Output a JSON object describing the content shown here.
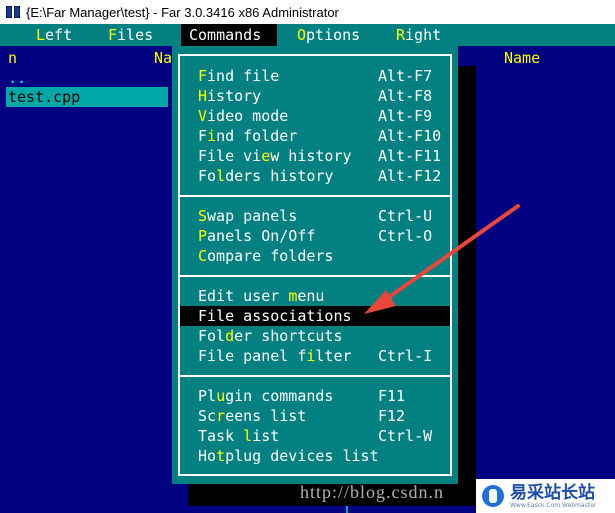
{
  "window": {
    "title": "{E:\\Far Manager\\test} - Far 3.0.3416 x86 Administrator"
  },
  "menubar": {
    "items": [
      {
        "hk": "L",
        "rest": "eft"
      },
      {
        "hk": "F",
        "rest": "iles"
      },
      {
        "hk": "C",
        "rest": "ommands"
      },
      {
        "hk": "O",
        "rest": "ptions"
      },
      {
        "hk": "R",
        "rest": "ight"
      }
    ]
  },
  "left_panel": {
    "col_left": "n",
    "col_right": "Na",
    "files": [
      "..",
      "test.cpp"
    ]
  },
  "right_panel": {
    "col": "Name"
  },
  "commands_menu": {
    "items": [
      {
        "pre": "",
        "hk": "F",
        "post": "ind file",
        "key": "Alt-F7"
      },
      {
        "pre": "",
        "hk": "H",
        "post": "istory",
        "key": "Alt-F8"
      },
      {
        "pre": "",
        "hk": "V",
        "post": "ideo mode",
        "key": "Alt-F9"
      },
      {
        "pre": "F",
        "hk": "i",
        "post": "nd folder",
        "key": "Alt-F10"
      },
      {
        "pre": "File vi",
        "hk": "e",
        "post": "w history",
        "key": "Alt-F11"
      },
      {
        "pre": "Fo",
        "hk": "l",
        "post": "ders history",
        "key": "Alt-F12"
      },
      {
        "pre": "",
        "hk": "S",
        "post": "wap panels",
        "key": "Ctrl-U"
      },
      {
        "pre": "",
        "hk": "P",
        "post": "anels On/Off",
        "key": "Ctrl-O"
      },
      {
        "pre": "",
        "hk": "C",
        "post": "ompare folders",
        "key": ""
      },
      {
        "pre": "Edit user ",
        "hk": "m",
        "post": "enu",
        "key": ""
      },
      {
        "pre": "File ",
        "hk": "a",
        "post": "ssociations",
        "key": ""
      },
      {
        "pre": "Fol",
        "hk": "d",
        "post": "er shortcuts",
        "key": ""
      },
      {
        "pre": "File panel f",
        "hk": "i",
        "post": "lter",
        "key": "Ctrl-I"
      },
      {
        "pre": "Pl",
        "hk": "u",
        "post": "gin commands",
        "key": "F11"
      },
      {
        "pre": "Sc",
        "hk": "r",
        "post": "eens list",
        "key": "F12"
      },
      {
        "pre": "Task ",
        "hk": "l",
        "post": "ist",
        "key": "Ctrl-W"
      },
      {
        "pre": "Ho",
        "hk": "t",
        "post": "plug devices list",
        "key": ""
      }
    ]
  },
  "watermark": {
    "text": "http://blog.csdn.n"
  },
  "brand": {
    "text": "易采站长站",
    "sub": "Www.Easck.Com  Webmaster"
  },
  "colors": {
    "teal": "#008080",
    "navy": "#000080",
    "hotkey": "#ffff00",
    "arrow": "#e8473a"
  }
}
